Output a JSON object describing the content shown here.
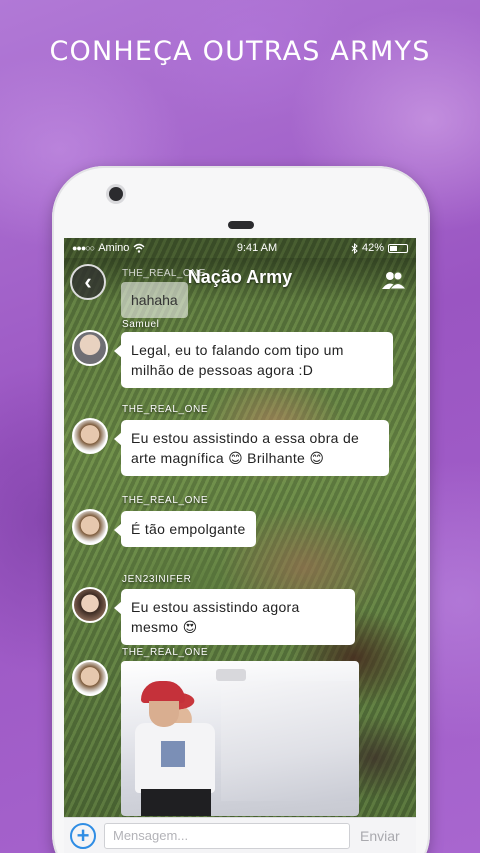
{
  "promo": {
    "headline": "CONHEÇA OUTRAS ARMYS"
  },
  "status_bar": {
    "signal": "●●●○○",
    "carrier": "Amino",
    "time": "9:41 AM",
    "battery": "42%"
  },
  "chat": {
    "title": "Nação Army",
    "back_icon": "chevron-left-icon",
    "members_icon": "people-icon"
  },
  "messages": [
    {
      "user": "THE_REAL_ONE",
      "text": "hahaha",
      "avatar_icon": "avatar-the-real-one"
    },
    {
      "user": "Samuel",
      "text": "Legal, eu to falando com tipo um milhão de pessoas agora :D",
      "avatar_icon": "avatar-samuel"
    },
    {
      "user": "THE_REAL_ONE",
      "text": "Eu estou assistindo a essa obra de arte magnífica 😊 Brilhante 😊",
      "avatar_icon": "avatar-the-real-one"
    },
    {
      "user": "THE_REAL_ONE",
      "text": "É tão empolgante",
      "avatar_icon": "avatar-the-real-one"
    },
    {
      "user": "JEN23INIFER",
      "text": "Eu estou assistindo agora mesmo 😍",
      "avatar_icon": "avatar-jen23inifer"
    },
    {
      "user": "THE_REAL_ONE",
      "type": "image",
      "avatar_icon": "avatar-the-real-one"
    }
  ],
  "composer": {
    "placeholder": "Mensagem...",
    "send_label": "Enviar",
    "add_icon": "plus-circle-icon"
  },
  "colors": {
    "background": "#a463c6",
    "accent_blue": "#2f8de4",
    "bubble": "#ffffff"
  }
}
